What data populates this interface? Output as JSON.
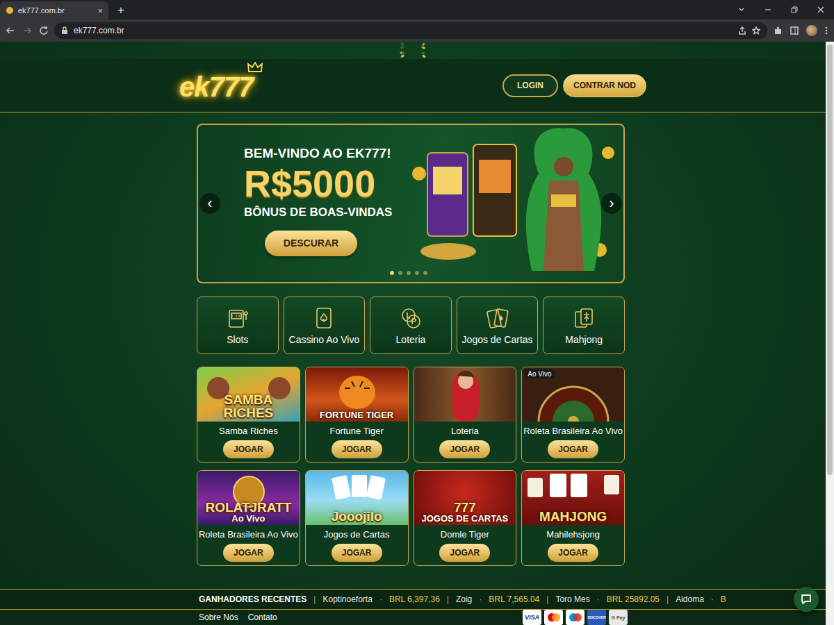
{
  "browser": {
    "tab": {
      "title": "ek777.com.br",
      "close": "×"
    },
    "new_tab": "+",
    "url": "ek777.com.br"
  },
  "header": {
    "logo": "ek777",
    "buttons": [
      {
        "label": "LOGIN",
        "kind": "outline"
      },
      {
        "label": "CONTRAR NOD",
        "kind": "filled"
      }
    ]
  },
  "banner": {
    "greeting": "BEM-VINDO AO EK777!",
    "amount": "R$5000",
    "subtitle": "BÔNUS DE BOAS-VINDAS",
    "button": "DESCURAR",
    "prev": "‹",
    "next": "›",
    "dots": [
      {
        "selected": true
      },
      {
        "selected": false
      },
      {
        "selected": false
      },
      {
        "selected": false
      },
      {
        "selected": false
      }
    ]
  },
  "categories": [
    {
      "label": "Slots",
      "kind": "slots"
    },
    {
      "label": "Cassino Ao Vivo",
      "kind": "live"
    },
    {
      "label": "Loteria",
      "kind": "lottery"
    },
    {
      "label": "Jogos de Cartas",
      "kind": "cards"
    },
    {
      "label": "Mahjong",
      "kind": "mahjong"
    }
  ],
  "games": [
    {
      "kind": "slot",
      "art": [
        "SAMBA",
        "RICHES"
      ],
      "name": "Samba Riches",
      "button": "JOGAR"
    },
    {
      "kind": "tiger",
      "art": [
        "FORTUNE TIGER"
      ],
      "name": "Fortune Tiger",
      "button": "JOGAR"
    },
    {
      "kind": "dealer",
      "art": [],
      "name": "Loteria",
      "button": "JOGAR"
    },
    {
      "kind": "roulette",
      "art": [],
      "badge": "Ao Vivo",
      "name": "Roleta Brasileira Ao Vivo",
      "button": "JOGAR"
    },
    {
      "kind": "neon",
      "art": [
        "ROLATJRATT",
        "Ao Vivo"
      ],
      "name": "Roleta Brasileira Ao Vivo",
      "button": "JOGAR"
    },
    {
      "kind": "cards",
      "art": [
        "Jooojilo"
      ],
      "name": "Jogos de Cartas",
      "button": "JOGAR"
    },
    {
      "kind": "lucky",
      "art": [
        "777",
        "JOGOS DE CARTAS"
      ],
      "name": "Domle Tiger",
      "button": "JOGAR"
    },
    {
      "kind": "mahjong",
      "art": [
        "MAHJONG"
      ],
      "name": "Mahilehsjong",
      "button": "JOGAR"
    }
  ],
  "winners": {
    "label": "GANHADORES RECENTES",
    "separator": "|",
    "joiner": "·",
    "entries": [
      {
        "name": "Koptinoeforta",
        "amount": "BRL 6,397,36"
      },
      {
        "name": "Zoig",
        "amount": "BRL 7,565.04"
      },
      {
        "name": "Toro Mes",
        "amount": "BRL 25892.05"
      },
      {
        "name": "Aldoma",
        "amount": "B"
      }
    ]
  },
  "footer": {
    "links": [
      "Sobre Nós",
      "Contato"
    ],
    "payments": [
      {
        "kind": "visa",
        "label": "VISA"
      },
      {
        "kind": "mastercard"
      },
      {
        "kind": "maestro"
      },
      {
        "kind": "discover",
        "label": "DISCOVER"
      },
      {
        "kind": "gpay",
        "label": "G Pay"
      }
    ]
  }
}
